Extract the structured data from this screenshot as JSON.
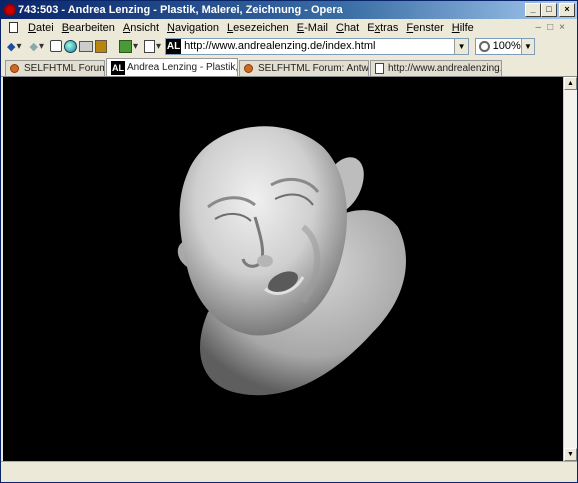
{
  "window": {
    "title": "743:503 - Andrea Lenzing - Plastik, Malerei, Zeichnung - Opera"
  },
  "menu": {
    "items": [
      {
        "label": "Datei",
        "accel": "D",
        "rest": "atei"
      },
      {
        "label": "Bearbeiten",
        "accel": "B",
        "rest": "earbeiten"
      },
      {
        "label": "Ansicht",
        "accel": "A",
        "rest": "nsicht"
      },
      {
        "label": "Navigation",
        "accel": "N",
        "rest": "avigation"
      },
      {
        "label": "Lesezeichen",
        "accel": "L",
        "rest": "esezeichen"
      },
      {
        "label": "E-Mail",
        "accel": "E",
        "rest": "-Mail"
      },
      {
        "label": "Chat",
        "accel": "C",
        "rest": "hat"
      },
      {
        "label": "Extras",
        "accel": "x",
        "pre": "E",
        "rest": "tras"
      },
      {
        "label": "Fenster",
        "accel": "F",
        "rest": "enster"
      },
      {
        "label": "Hilfe",
        "accel": "H",
        "rest": "ilfe"
      }
    ]
  },
  "address": {
    "url": "http://www.andrealenzing.de/index.html",
    "logo_text": "AL"
  },
  "zoom": {
    "value": "100%"
  },
  "tabs": [
    {
      "label": "SELFHTML Forum",
      "favicon": "selfhtml-icon",
      "active": false
    },
    {
      "label": "Andrea Lenzing - Plastik, ...",
      "favicon": "al-logo",
      "active": true
    },
    {
      "label": "SELFHTML Forum: Antwor...",
      "favicon": "selfhtml-icon",
      "active": false
    },
    {
      "label": "http://www.andrealenzing....",
      "favicon": "page-icon",
      "active": false
    }
  ],
  "content": {
    "image": "sculpture-head",
    "background": "#000000"
  }
}
